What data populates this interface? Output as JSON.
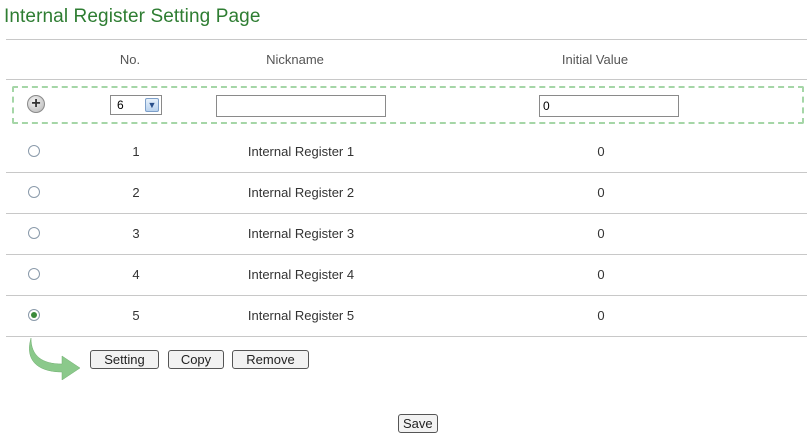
{
  "page_title": "Internal Register Setting Page",
  "table": {
    "headers": {
      "no": "No.",
      "nickname": "Nickname",
      "initial_value": "Initial Value"
    },
    "add_row": {
      "no_selected": "6",
      "nickname_value": "",
      "initial_value": "0"
    },
    "rows": [
      {
        "selected": false,
        "no": "1",
        "nickname": "Internal Register 1",
        "initial_value": "0"
      },
      {
        "selected": false,
        "no": "2",
        "nickname": "Internal Register 2",
        "initial_value": "0"
      },
      {
        "selected": false,
        "no": "3",
        "nickname": "Internal Register 3",
        "initial_value": "0"
      },
      {
        "selected": false,
        "no": "4",
        "nickname": "Internal Register 4",
        "initial_value": "0"
      },
      {
        "selected": true,
        "no": "5",
        "nickname": "Internal Register 5",
        "initial_value": "0"
      }
    ]
  },
  "actions": {
    "setting": "Setting",
    "copy": "Copy",
    "remove": "Remove"
  },
  "save_label": "Save",
  "icons": {
    "add": "plus-circle-icon",
    "arrow": "curved-arrow-icon",
    "dropdown": "chevron-down-icon"
  },
  "colors": {
    "title": "#2e7d32",
    "dashed_border": "#a5d6a7",
    "arrow": "#8bc98b"
  }
}
